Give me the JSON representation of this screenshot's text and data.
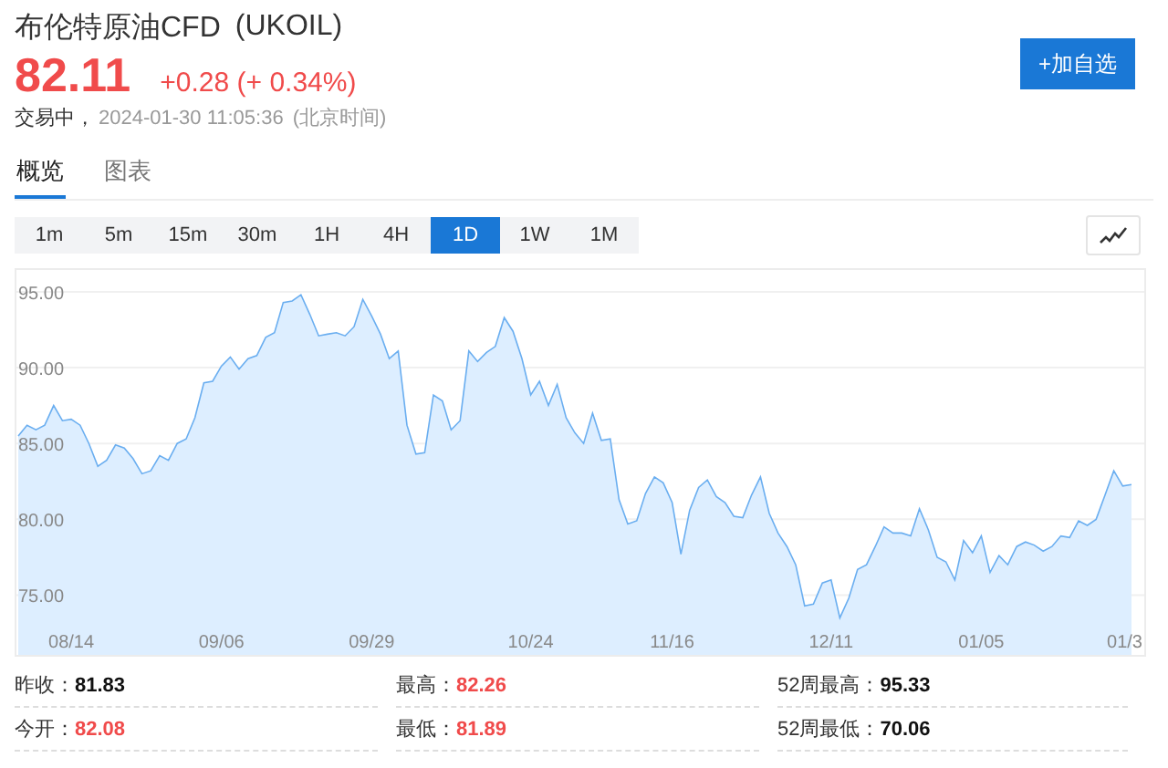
{
  "header": {
    "title": "布伦特原油CFD",
    "symbol": "(UKOIL)",
    "price": "82.11",
    "change": "+0.28",
    "change_pct": "(+ 0.34%)",
    "status": "交易中，",
    "time": "2024-01-30 11:05:36",
    "timezone": "(北京时间)",
    "watch_button": "+加自选"
  },
  "tabs": [
    {
      "label": "概览",
      "selected": true
    },
    {
      "label": "图表",
      "selected": false
    }
  ],
  "intervals": [
    {
      "label": "1m",
      "selected": false
    },
    {
      "label": "5m",
      "selected": false
    },
    {
      "label": "15m",
      "selected": false
    },
    {
      "label": "30m",
      "selected": false
    },
    {
      "label": "1H",
      "selected": false
    },
    {
      "label": "4H",
      "selected": false
    },
    {
      "label": "1D",
      "selected": true
    },
    {
      "label": "1W",
      "selected": false
    },
    {
      "label": "1M",
      "selected": false
    }
  ],
  "chart_data": {
    "type": "area",
    "grid": true,
    "ylim": [
      71,
      96.5
    ],
    "categories": [
      null,
      null,
      null,
      null,
      null,
      null,
      "08/14",
      null,
      null,
      null,
      null,
      null,
      null,
      null,
      null,
      null,
      null,
      null,
      null,
      null,
      null,
      null,
      null,
      "09/06",
      null,
      null,
      null,
      null,
      null,
      null,
      null,
      null,
      null,
      null,
      null,
      null,
      null,
      null,
      null,
      null,
      "09/29",
      null,
      null,
      null,
      null,
      null,
      null,
      null,
      null,
      null,
      null,
      null,
      null,
      null,
      null,
      null,
      null,
      null,
      "10/24",
      null,
      null,
      null,
      null,
      null,
      null,
      null,
      null,
      null,
      null,
      null,
      null,
      null,
      null,
      null,
      "11/16",
      null,
      null,
      null,
      null,
      null,
      null,
      null,
      null,
      null,
      null,
      null,
      null,
      null,
      null,
      null,
      null,
      null,
      "12/11",
      null,
      null,
      null,
      null,
      null,
      null,
      null,
      null,
      null,
      null,
      null,
      null,
      null,
      null,
      null,
      null,
      "01/05",
      null,
      null,
      null,
      null,
      null,
      null,
      null,
      null,
      null,
      null,
      null,
      null,
      null,
      null,
      null,
      "01/3",
      null
    ],
    "yticks": [
      {
        "value": 75,
        "label": "75.00"
      },
      {
        "value": 80,
        "label": "80.00"
      },
      {
        "value": 85,
        "label": "85.00"
      },
      {
        "value": 90,
        "label": "90.00"
      },
      {
        "value": 95,
        "label": "95.00"
      }
    ],
    "series": [
      {
        "color": "#6aaef0",
        "values": [
          85.5,
          86.2,
          85.9,
          86.2,
          87.5,
          86.5,
          86.6,
          86.2,
          85,
          83.5,
          83.9,
          84.9,
          84.7,
          84.0,
          83.0,
          83.2,
          84.2,
          83.9,
          85,
          85.3,
          86.7,
          89.0,
          89.1,
          90.1,
          90.7,
          89.9,
          90.6,
          90.8,
          92,
          92.3,
          94.3,
          94.4,
          94.8,
          93.5,
          92.1,
          92.2,
          92.3,
          92.1,
          92.7,
          94.5,
          93.4,
          92.2,
          90.6,
          91.1,
          86.2,
          84.3,
          84.4,
          88.2,
          87.8,
          85.9,
          86.5,
          91.1,
          90.4,
          91,
          91.4,
          93.3,
          92.4,
          90.6,
          88.2,
          89.1,
          87.5,
          88.9,
          86.7,
          85.7,
          85,
          87,
          85.2,
          85.3,
          81.3,
          79.7,
          79.9,
          81.7,
          82.8,
          82.4,
          81.1,
          77.7,
          80.6,
          82.1,
          82.6,
          81.5,
          81.1,
          80.2,
          80.1,
          81.6,
          82.8,
          80.4,
          79.1,
          78.2,
          77,
          74.3,
          74.4,
          75.8,
          76,
          73.5,
          74.8,
          76.7,
          77,
          78.2,
          79.5,
          79.1,
          79.1,
          78.9,
          80.7,
          79.3,
          77.5,
          77.2,
          76,
          78.6,
          77.8,
          78.9,
          76.5,
          77.6,
          77,
          78.2,
          78.5,
          78.3,
          77.9,
          78.2,
          78.9,
          78.8,
          79.9,
          79.6,
          80,
          81.6,
          83.2,
          82.2,
          82.3
        ]
      }
    ]
  },
  "stats": [
    {
      "label": "昨收：",
      "value": "81.83",
      "kind": "plain"
    },
    {
      "label": "最高：",
      "value": "82.26",
      "kind": "up"
    },
    {
      "label": "52周最高：",
      "value": "95.33",
      "kind": "plain"
    },
    {
      "label": "今开：",
      "value": "82.08",
      "kind": "up"
    },
    {
      "label": "最低：",
      "value": "81.89",
      "kind": "up"
    },
    {
      "label": "52周最低：",
      "value": "70.06",
      "kind": "plain"
    }
  ]
}
